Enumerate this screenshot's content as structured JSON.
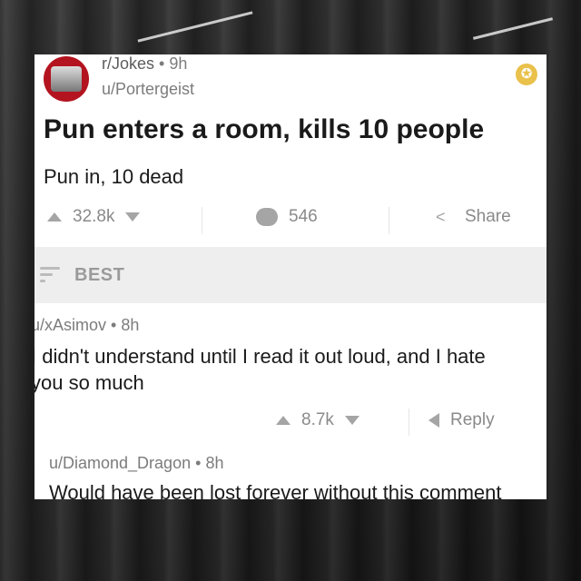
{
  "post": {
    "subreddit": "r/Jokes",
    "age": "9h",
    "author": "u/Portergeist",
    "title": "Pun enters a room, kills 10 people",
    "body": "Pun in, 10 dead",
    "score": "32.8k",
    "comments": "546",
    "share_label": "Share"
  },
  "sort": {
    "label": "BEST"
  },
  "comments": [
    {
      "author": "u/xAsimov",
      "age": "8h",
      "text": "I didn't understand until I read it out loud, and I hate you so much",
      "score": "8.7k",
      "reply_label": "Reply"
    },
    {
      "author": "u/Diamond_Dragon",
      "age": "8h",
      "text": "Would have been lost forever without this comment"
    }
  ],
  "separator": "•",
  "colors": {
    "award": "#e9c14b",
    "avatar": "#b3141f",
    "meta_text": "#7c7c7c"
  },
  "icons": [
    "subreddit-avatar-icon",
    "award-icon",
    "upvote-icon",
    "downvote-icon",
    "comment-icon",
    "share-icon",
    "sort-icon",
    "reply-icon"
  ]
}
